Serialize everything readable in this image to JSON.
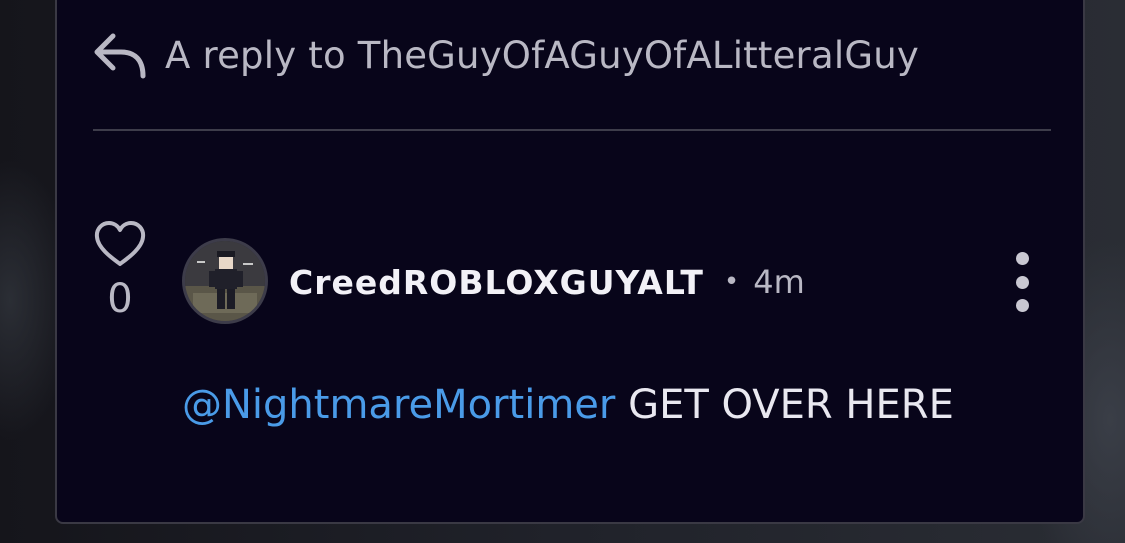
{
  "reply": {
    "icon": "reply-arrow-icon",
    "label": "A reply to TheGuyOfAGuyOfALitteralGuy"
  },
  "comment": {
    "like_icon": "heart-outline-icon",
    "like_count": "0",
    "avatar_icon": "user-avatar",
    "username": "CreedROBLOXGUYALT",
    "separator": "•",
    "timestamp": "4m",
    "more_icon": "more-vertical-icon",
    "mention": "@NightmareMortimer",
    "message": "GET OVER HERE"
  },
  "colors": {
    "card_background": "#08051a",
    "mention": "#4a9be8",
    "muted_text": "#b9b8c4",
    "primary_text": "#f2f1f7"
  }
}
